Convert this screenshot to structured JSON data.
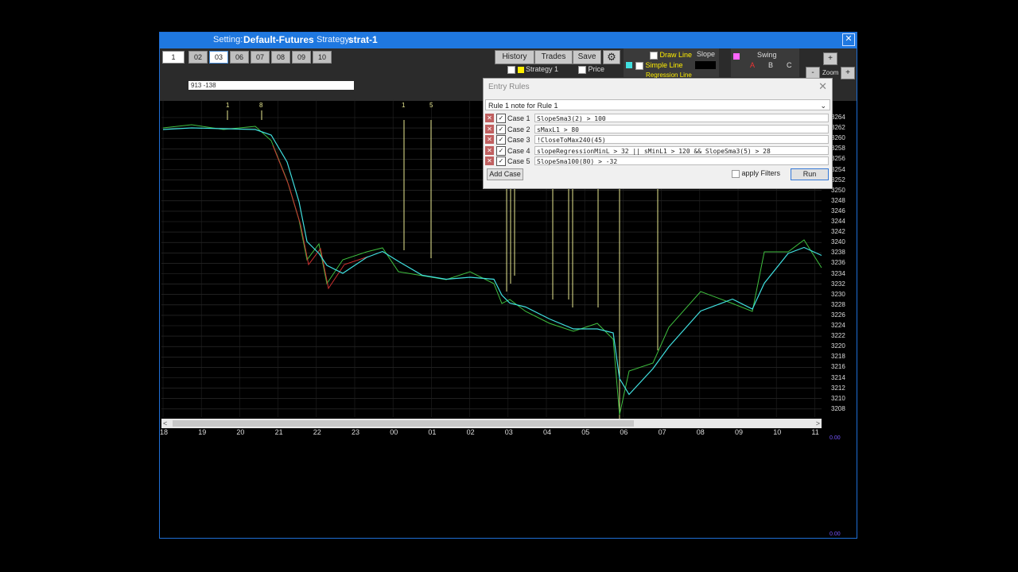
{
  "window": {
    "setting_label": "Setting:",
    "setting_value": "Default-Futures",
    "strategy_label": "Strategy:",
    "strategy_value": "strat-1",
    "close_glyph": "✕"
  },
  "toolbar": {
    "numbers": [
      "1",
      "02",
      "03",
      "06",
      "07",
      "08",
      "09",
      "10"
    ],
    "info_line": "913   -138",
    "history": "History",
    "trades": "Trades",
    "save": "Save",
    "strategy1": "Strategy 1",
    "price": "Price",
    "draw_line": "Draw Line",
    "slope": "Slope",
    "simple_line": "Simple  Line",
    "regression_line": "Regression Line",
    "swing": "Swing",
    "swing_a": "A",
    "swing_b": "B",
    "swing_c": "C",
    "zoom": "Zoom",
    "zoom_plus": "+",
    "zoom_minus": "-"
  },
  "entry_rules": {
    "title": "Entry Rules",
    "close": "✕",
    "rule": "Rule 1  note for Rule 1",
    "cases": [
      {
        "label": "Case 1",
        "expr": "SlopeSma3(2) > 100"
      },
      {
        "label": "Case 2",
        "expr": "sMaxL1 > 80"
      },
      {
        "label": "Case 3",
        "expr": "!CloseToMax240(45)"
      },
      {
        "label": "Case 4",
        "expr": "slopeRegressionMinL > 32 || sMinL1 > 120 && SlopeSma3(5) > 28"
      },
      {
        "label": "Case 5",
        "expr": "SlopeSma100(80) > -32"
      }
    ],
    "add_case": "Add Case",
    "apply_filters": "apply Filters",
    "run": "Run"
  },
  "chart": {
    "y_ticks": [
      "3264",
      "3262",
      "3260",
      "3258",
      "3256",
      "3254",
      "3252",
      "3250",
      "3248",
      "3246",
      "3244",
      "3242",
      "3240",
      "3238",
      "3236",
      "3234",
      "3232",
      "3230",
      "3228",
      "3226",
      "3224",
      "3222",
      "3220",
      "3218",
      "3216",
      "3214",
      "3212",
      "3210",
      "3208"
    ],
    "x_ticks": [
      "18",
      "19",
      "20",
      "21",
      "22",
      "23",
      "00",
      "01",
      "02",
      "03",
      "04",
      "05",
      "06",
      "07",
      "08",
      "09",
      "10",
      "11"
    ],
    "markers": [
      "1",
      "8",
      "1",
      "5"
    ],
    "scroll_left": "<",
    "scroll_right": ">",
    "lower_value_top": "0.00",
    "lower_value_bottom": "0.00"
  },
  "colors": {
    "accent": "#1f78e0",
    "price_green": "#3fbf3f",
    "price_red": "#d03030",
    "sma_cyan": "#40e0e0",
    "marker_yellow": "#e8e890"
  }
}
